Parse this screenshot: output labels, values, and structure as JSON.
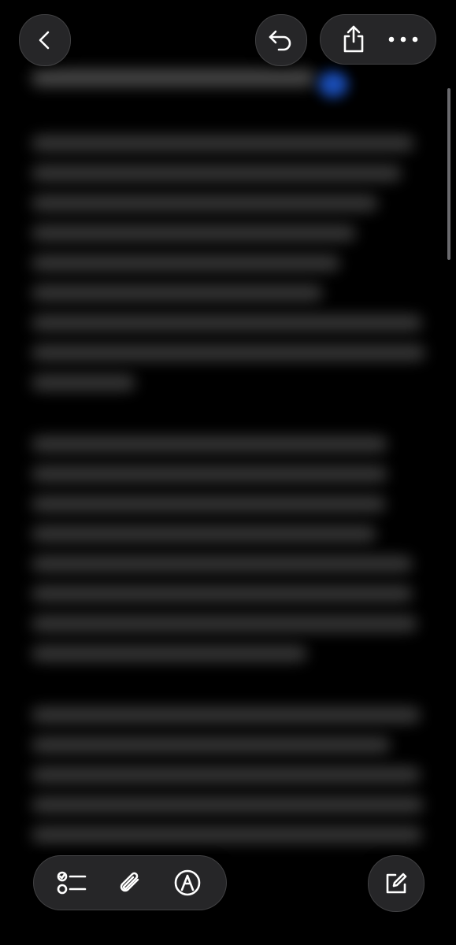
{
  "toolbar_top": {
    "back_icon": "chevron-left-icon",
    "undo_icon": "undo-icon",
    "share_icon": "share-icon",
    "more_icon": "ellipsis-icon"
  },
  "note": {
    "blurred": true,
    "emoji_color": "#1f5bd6"
  },
  "toolbar_bottom": {
    "checklist_icon": "checklist-icon",
    "attachment_icon": "paperclip-icon",
    "markup_icon": "pen-tip-icon",
    "compose_icon": "compose-icon"
  },
  "colors": {
    "background": "#000000",
    "button_fill": "#2a2a2c",
    "icon": "#ffffff"
  }
}
